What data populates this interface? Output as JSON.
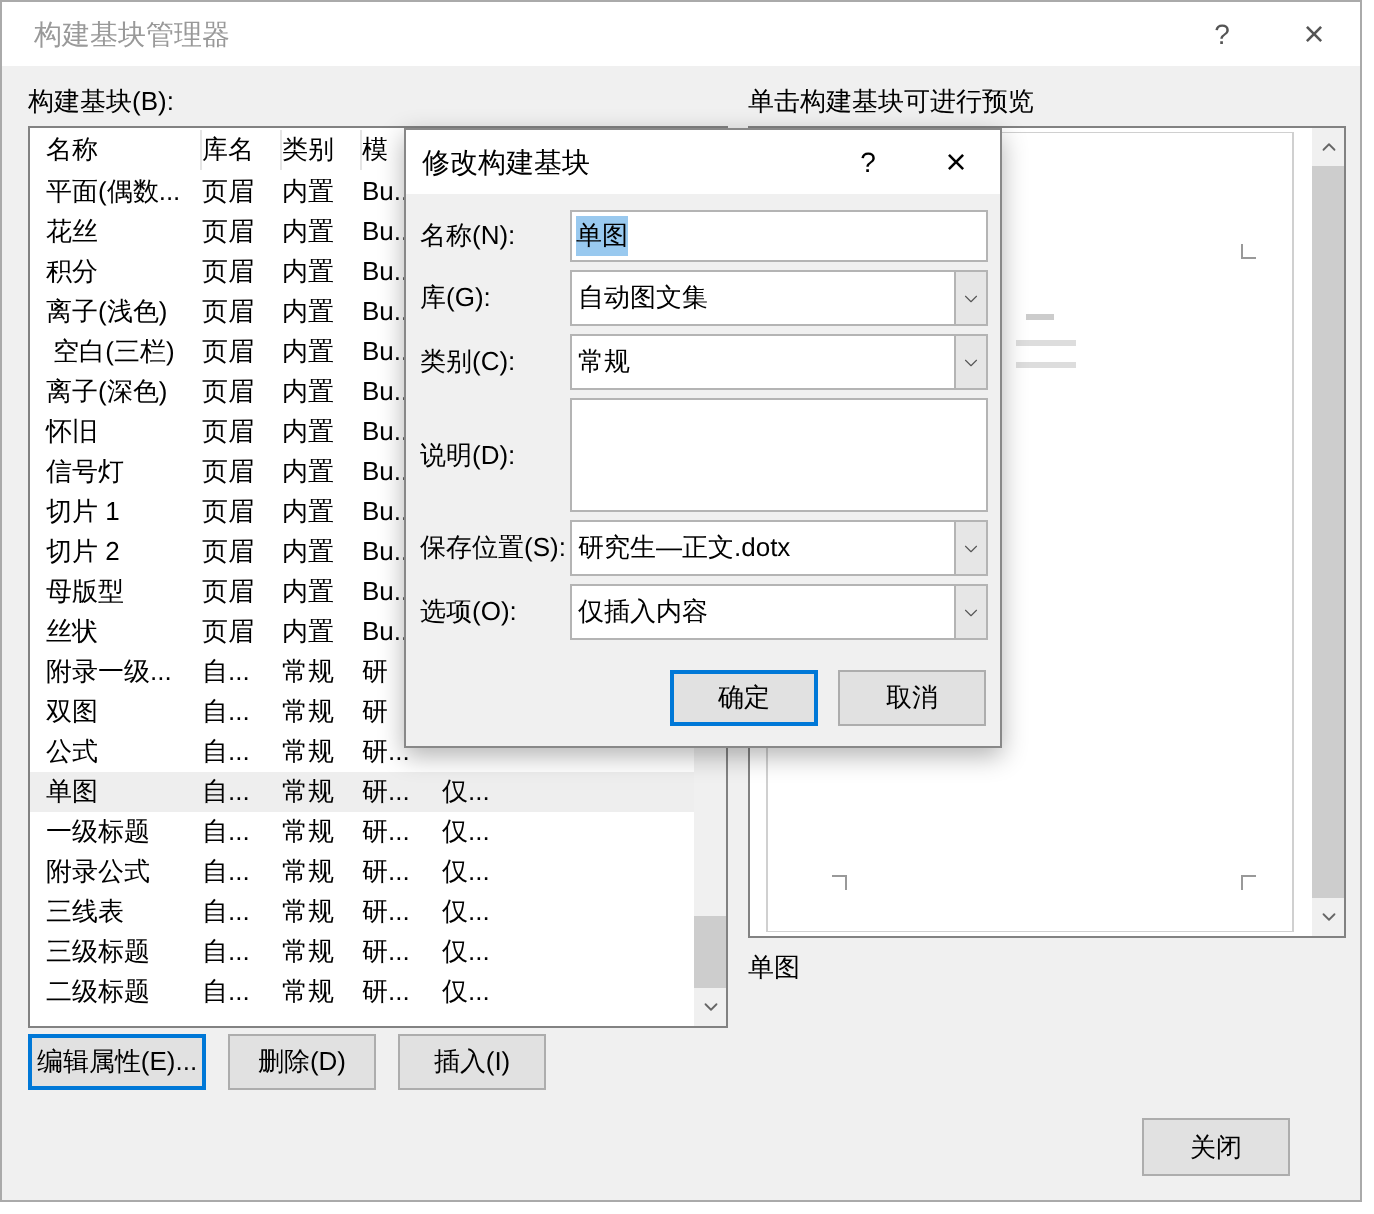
{
  "window": {
    "title": "构建基块管理器",
    "help": "?",
    "close": "×"
  },
  "list": {
    "label": "构建基块(B):",
    "columns": [
      "名称",
      "库名",
      "类别",
      "模"
    ],
    "rows": [
      {
        "name": "平面(偶数...",
        "gallery": "页眉",
        "category": "内置",
        "template": "Bu..",
        "selected": false
      },
      {
        "name": "花丝",
        "gallery": "页眉",
        "category": "内置",
        "template": "Bu..",
        "selected": false
      },
      {
        "name": "积分",
        "gallery": "页眉",
        "category": "内置",
        "template": "Bu..",
        "selected": false
      },
      {
        "name": "离子(浅色)",
        "gallery": "页眉",
        "category": "内置",
        "template": "Bu..",
        "selected": false
      },
      {
        "name": " 空白(三栏)",
        "gallery": "页眉",
        "category": "内置",
        "template": "Bu..",
        "selected": false
      },
      {
        "name": "离子(深色)",
        "gallery": "页眉",
        "category": "内置",
        "template": "Bu..",
        "selected": false
      },
      {
        "name": "怀旧",
        "gallery": "页眉",
        "category": "内置",
        "template": "Bu..",
        "selected": false
      },
      {
        "name": "信号灯",
        "gallery": "页眉",
        "category": "内置",
        "template": "Bu..",
        "selected": false
      },
      {
        "name": "切片 1",
        "gallery": "页眉",
        "category": "内置",
        "template": "Bu..",
        "selected": false
      },
      {
        "name": "切片 2",
        "gallery": "页眉",
        "category": "内置",
        "template": "Bu..",
        "selected": false
      },
      {
        "name": "母版型",
        "gallery": "页眉",
        "category": "内置",
        "template": "Bu..",
        "selected": false
      },
      {
        "name": "丝状",
        "gallery": "页眉",
        "category": "内置",
        "template": "Bu..",
        "selected": false
      },
      {
        "name": "附录一级...",
        "gallery": "自...",
        "category": "常规",
        "template": "研",
        "selected": false
      },
      {
        "name": "双图",
        "gallery": "自...",
        "category": "常规",
        "template": "研",
        "selected": false
      },
      {
        "name": "公式",
        "gallery": "自...",
        "category": "常规",
        "template": "研...",
        "selected": false
      },
      {
        "name": "单图",
        "gallery": "自...",
        "category": "常规",
        "template": "研...",
        "behavior": "仅...",
        "selected": true
      },
      {
        "name": "一级标题",
        "gallery": "自...",
        "category": "常规",
        "template": "研...",
        "behavior": "仅...",
        "selected": false
      },
      {
        "name": "附录公式",
        "gallery": "自...",
        "category": "常规",
        "template": "研...",
        "behavior": "仅...",
        "selected": false
      },
      {
        "name": "三线表",
        "gallery": "自...",
        "category": "常规",
        "template": "研...",
        "behavior": "仅...",
        "selected": false
      },
      {
        "name": "三级标题",
        "gallery": "自...",
        "category": "常规",
        "template": "研...",
        "behavior": "仅...",
        "selected": false
      },
      {
        "name": "二级标题",
        "gallery": "自...",
        "category": "常规",
        "template": "研...",
        "behavior": "仅...",
        "selected": false
      }
    ]
  },
  "buttons": [
    {
      "label": "编辑属性(E)...",
      "default": true
    },
    {
      "label": "删除(D)",
      "default": false
    },
    {
      "label": "插入(I)",
      "default": false
    }
  ],
  "preview": {
    "label": "单击构建基块可进行预览",
    "caption": "单图"
  },
  "close_button": "关闭",
  "modal": {
    "title": "修改构建基块",
    "help": "?",
    "close": "×",
    "fields": [
      {
        "kind": "text",
        "label": "名称(N):",
        "value": "单图",
        "highlighted": true
      },
      {
        "kind": "select",
        "label": "库(G):",
        "value": "自动图文集"
      },
      {
        "kind": "select",
        "label": "类别(C):",
        "value": "常规"
      },
      {
        "kind": "textarea",
        "label": "说明(D):"
      },
      {
        "kind": "select",
        "label": "保存位置(S):",
        "value": "研究生—正文.dotx"
      },
      {
        "kind": "select",
        "label": "选项(O):",
        "value": "仅插入内容"
      }
    ],
    "buttons": [
      {
        "label": "确定",
        "default": true
      },
      {
        "label": "取消",
        "default": false
      }
    ]
  }
}
